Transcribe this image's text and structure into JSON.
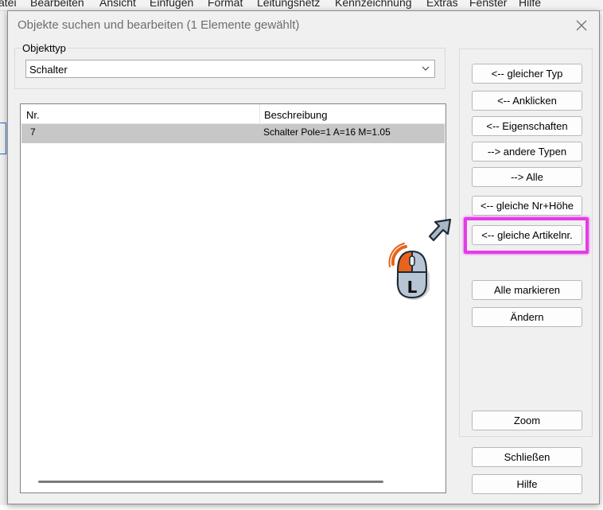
{
  "menu": [
    "atei",
    "Bearbeiten",
    "Ansicht",
    "Einfügen",
    "Format",
    "Leitungsnetz",
    "Kennzeichnung",
    "Extras",
    "Fenster",
    "Hilfe"
  ],
  "dialog": {
    "title": "Objekte suchen und bearbeiten (1 Elemente gewählt)",
    "close_icon": "close-icon"
  },
  "objekttyp": {
    "label": "Objekttyp",
    "selected": "Schalter"
  },
  "list": {
    "columns": [
      "Nr.",
      "Beschreibung"
    ],
    "rows": [
      {
        "nr": "7",
        "beschreibung": "Schalter Pole=1 A=16 M=1.05"
      }
    ]
  },
  "buttons": {
    "gleicher_typ": "<-- gleicher Typ",
    "anklicken": "<-- Anklicken",
    "eigenschaften": "<-- Eigenschaften",
    "andere_typen": "--> andere Typen",
    "alle": "--> Alle",
    "gleiche_nr_hoehe": "<-- gleiche Nr+Höhe",
    "gleiche_artikelnr": "<-- gleiche Artikelnr.",
    "alle_markieren": "Alle markieren",
    "aendern": "Ändern",
    "zoom": "Zoom",
    "schliessen": "Schließen",
    "hilfe": "Hilfe"
  },
  "annotation": {
    "mouse_button": "L",
    "highlight_color": "#e43ce6",
    "mouse_accent_color": "#e8631c"
  }
}
